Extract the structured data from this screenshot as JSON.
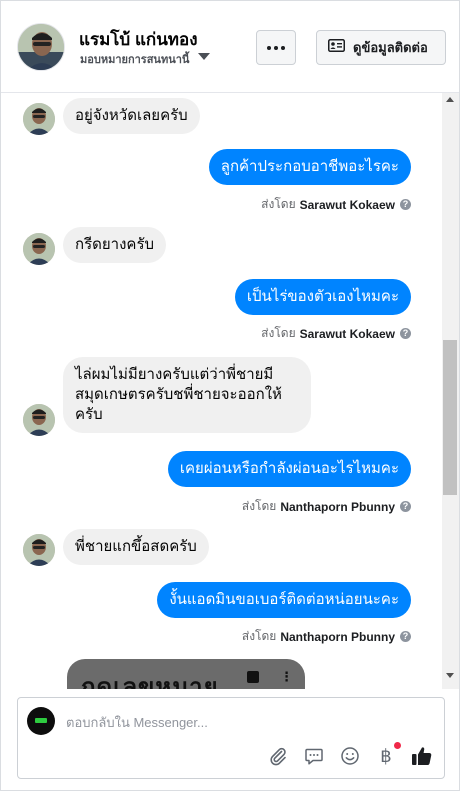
{
  "header": {
    "name": "แรมโบ้ แก่นทอง",
    "subtitle": "มอบหมายการสนทนานี้",
    "contact_label": "ดูข้อมูลติดต่อ"
  },
  "messages": [
    {
      "dir": "in",
      "text": "อยู่จังหวัดเลยครับ"
    },
    {
      "dir": "out",
      "text": "ลูกค้าประกอบอาชีพอะไรคะ",
      "sent_prefix": "ส่งโดย",
      "sent_by": "Sarawut Kokaew"
    },
    {
      "dir": "in",
      "text": "กรีดยางครับ"
    },
    {
      "dir": "out",
      "text": "เป็นไร่ของตัวเองไหมคะ",
      "sent_prefix": "ส่งโดย",
      "sent_by": "Sarawut Kokaew"
    },
    {
      "dir": "in",
      "text": "ไล่ผมไม่มียางครับแต่ว่าพี่ชายมีสมุดเกษตรครับชพี่ชายจะออกให้ครับ"
    },
    {
      "dir": "out",
      "text": "เคยผ่อนหรือกำลังผ่อนอะไรไหมคะ",
      "sent_prefix": "ส่งโดย",
      "sent_by": "Nanthaporn Pbunny"
    },
    {
      "dir": "in",
      "text": "พี่ชายแกขึ้อสดครับ"
    },
    {
      "dir": "out",
      "text": "งั้นแอดมินขอเบอร์ติดต่อหน่อยนะคะ",
      "sent_prefix": "ส่งโดย",
      "sent_by": "Nanthaporn Pbunny"
    }
  ],
  "image_preview": {
    "text": "กดเลขหมาย"
  },
  "composer": {
    "placeholder": "ตอบกลับใน Messenger...",
    "currency_symbol": "฿"
  },
  "icons": [
    "more-icon",
    "contact-card-icon",
    "paperclip-icon",
    "comment-icon",
    "emoji-icon",
    "baht-icon",
    "like-icon"
  ],
  "colors": {
    "accent": "#0084ff",
    "incoming_bubble": "#f0f0f0",
    "badge": "#f02849"
  }
}
